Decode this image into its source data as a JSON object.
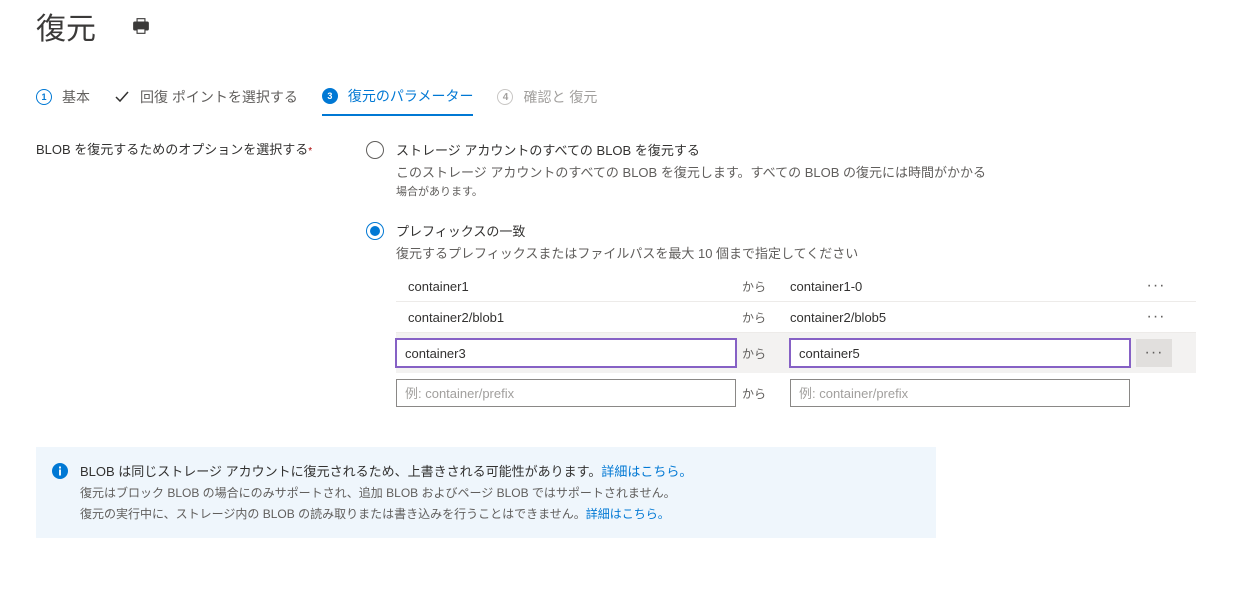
{
  "header": {
    "title": "復元"
  },
  "stepper": {
    "s1_num": "1",
    "s1_label": "基本",
    "s2_label": "回復 ポイントを選択する",
    "s3_num": "3",
    "s3_label": "復元のパラメーター",
    "s4_num": "4",
    "s4_label": "確認と 復元"
  },
  "form": {
    "option_label": "BLOB を復元するためのオプションを選択する"
  },
  "radio_all": {
    "label": "ストレージ アカウントのすべての BLOB を復元する",
    "desc_main": "このストレージ アカウントのすべての BLOB を復元します。すべての BLOB の復元には時間がかかる",
    "desc_sub": "場合があります。"
  },
  "radio_prefix": {
    "label": "プレフィックスの一致",
    "desc": "復元するプレフィックスまたはファイルパスを最大 10 個まで指定してください"
  },
  "prefix": {
    "kara": "から",
    "rows": [
      {
        "from": "container1",
        "to": "container1-0"
      },
      {
        "from": "container2/blob1",
        "to": "container2/blob5"
      }
    ],
    "active": {
      "from": "container3",
      "to": "container5"
    },
    "placeholder": "例: container/prefix"
  },
  "info": {
    "l1a": "BLOB は同じストレージ アカウントに復元されるため、上書きされる可能性があります。",
    "l1b": "詳細はこちら。",
    "l2": "復元はブロック BLOB の場合にのみサポートされ、追加 BLOB およびページ BLOB ではサポートされません。",
    "l3a": "復元の実行中に、ストレージ内の BLOB の読み取りまたは書き込みを行うことはできません。",
    "l3b": "詳細はこちら。"
  }
}
